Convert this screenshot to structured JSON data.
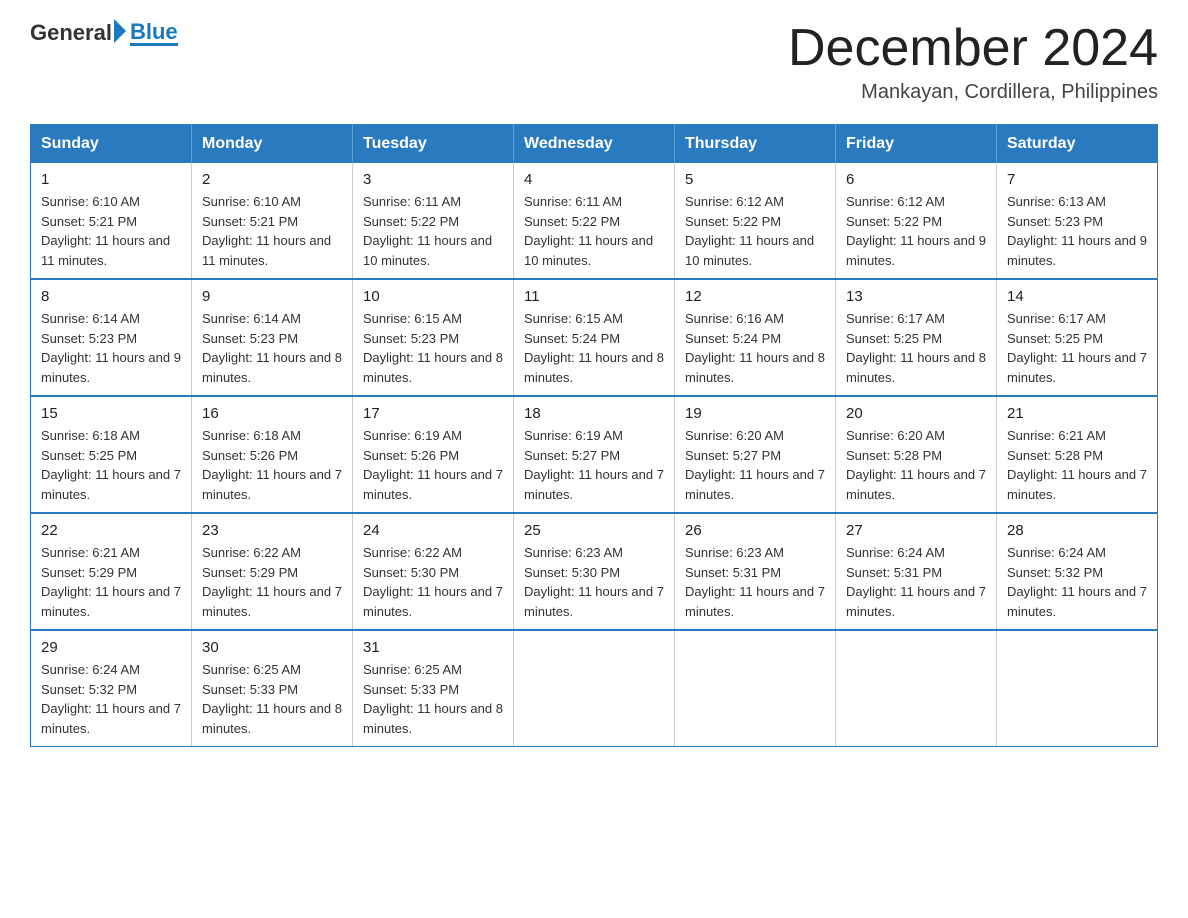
{
  "header": {
    "logo_general": "General",
    "logo_blue": "Blue",
    "title": "December 2024",
    "subtitle": "Mankayan, Cordillera, Philippines"
  },
  "calendar": {
    "days_of_week": [
      "Sunday",
      "Monday",
      "Tuesday",
      "Wednesday",
      "Thursday",
      "Friday",
      "Saturday"
    ],
    "weeks": [
      [
        {
          "day": "1",
          "sunrise": "6:10 AM",
          "sunset": "5:21 PM",
          "daylight": "11 hours and 11 minutes."
        },
        {
          "day": "2",
          "sunrise": "6:10 AM",
          "sunset": "5:21 PM",
          "daylight": "11 hours and 11 minutes."
        },
        {
          "day": "3",
          "sunrise": "6:11 AM",
          "sunset": "5:22 PM",
          "daylight": "11 hours and 10 minutes."
        },
        {
          "day": "4",
          "sunrise": "6:11 AM",
          "sunset": "5:22 PM",
          "daylight": "11 hours and 10 minutes."
        },
        {
          "day": "5",
          "sunrise": "6:12 AM",
          "sunset": "5:22 PM",
          "daylight": "11 hours and 10 minutes."
        },
        {
          "day": "6",
          "sunrise": "6:12 AM",
          "sunset": "5:22 PM",
          "daylight": "11 hours and 9 minutes."
        },
        {
          "day": "7",
          "sunrise": "6:13 AM",
          "sunset": "5:23 PM",
          "daylight": "11 hours and 9 minutes."
        }
      ],
      [
        {
          "day": "8",
          "sunrise": "6:14 AM",
          "sunset": "5:23 PM",
          "daylight": "11 hours and 9 minutes."
        },
        {
          "day": "9",
          "sunrise": "6:14 AM",
          "sunset": "5:23 PM",
          "daylight": "11 hours and 8 minutes."
        },
        {
          "day": "10",
          "sunrise": "6:15 AM",
          "sunset": "5:23 PM",
          "daylight": "11 hours and 8 minutes."
        },
        {
          "day": "11",
          "sunrise": "6:15 AM",
          "sunset": "5:24 PM",
          "daylight": "11 hours and 8 minutes."
        },
        {
          "day": "12",
          "sunrise": "6:16 AM",
          "sunset": "5:24 PM",
          "daylight": "11 hours and 8 minutes."
        },
        {
          "day": "13",
          "sunrise": "6:17 AM",
          "sunset": "5:25 PM",
          "daylight": "11 hours and 8 minutes."
        },
        {
          "day": "14",
          "sunrise": "6:17 AM",
          "sunset": "5:25 PM",
          "daylight": "11 hours and 7 minutes."
        }
      ],
      [
        {
          "day": "15",
          "sunrise": "6:18 AM",
          "sunset": "5:25 PM",
          "daylight": "11 hours and 7 minutes."
        },
        {
          "day": "16",
          "sunrise": "6:18 AM",
          "sunset": "5:26 PM",
          "daylight": "11 hours and 7 minutes."
        },
        {
          "day": "17",
          "sunrise": "6:19 AM",
          "sunset": "5:26 PM",
          "daylight": "11 hours and 7 minutes."
        },
        {
          "day": "18",
          "sunrise": "6:19 AM",
          "sunset": "5:27 PM",
          "daylight": "11 hours and 7 minutes."
        },
        {
          "day": "19",
          "sunrise": "6:20 AM",
          "sunset": "5:27 PM",
          "daylight": "11 hours and 7 minutes."
        },
        {
          "day": "20",
          "sunrise": "6:20 AM",
          "sunset": "5:28 PM",
          "daylight": "11 hours and 7 minutes."
        },
        {
          "day": "21",
          "sunrise": "6:21 AM",
          "sunset": "5:28 PM",
          "daylight": "11 hours and 7 minutes."
        }
      ],
      [
        {
          "day": "22",
          "sunrise": "6:21 AM",
          "sunset": "5:29 PM",
          "daylight": "11 hours and 7 minutes."
        },
        {
          "day": "23",
          "sunrise": "6:22 AM",
          "sunset": "5:29 PM",
          "daylight": "11 hours and 7 minutes."
        },
        {
          "day": "24",
          "sunrise": "6:22 AM",
          "sunset": "5:30 PM",
          "daylight": "11 hours and 7 minutes."
        },
        {
          "day": "25",
          "sunrise": "6:23 AM",
          "sunset": "5:30 PM",
          "daylight": "11 hours and 7 minutes."
        },
        {
          "day": "26",
          "sunrise": "6:23 AM",
          "sunset": "5:31 PM",
          "daylight": "11 hours and 7 minutes."
        },
        {
          "day": "27",
          "sunrise": "6:24 AM",
          "sunset": "5:31 PM",
          "daylight": "11 hours and 7 minutes."
        },
        {
          "day": "28",
          "sunrise": "6:24 AM",
          "sunset": "5:32 PM",
          "daylight": "11 hours and 7 minutes."
        }
      ],
      [
        {
          "day": "29",
          "sunrise": "6:24 AM",
          "sunset": "5:32 PM",
          "daylight": "11 hours and 7 minutes."
        },
        {
          "day": "30",
          "sunrise": "6:25 AM",
          "sunset": "5:33 PM",
          "daylight": "11 hours and 8 minutes."
        },
        {
          "day": "31",
          "sunrise": "6:25 AM",
          "sunset": "5:33 PM",
          "daylight": "11 hours and 8 minutes."
        },
        null,
        null,
        null,
        null
      ]
    ]
  }
}
